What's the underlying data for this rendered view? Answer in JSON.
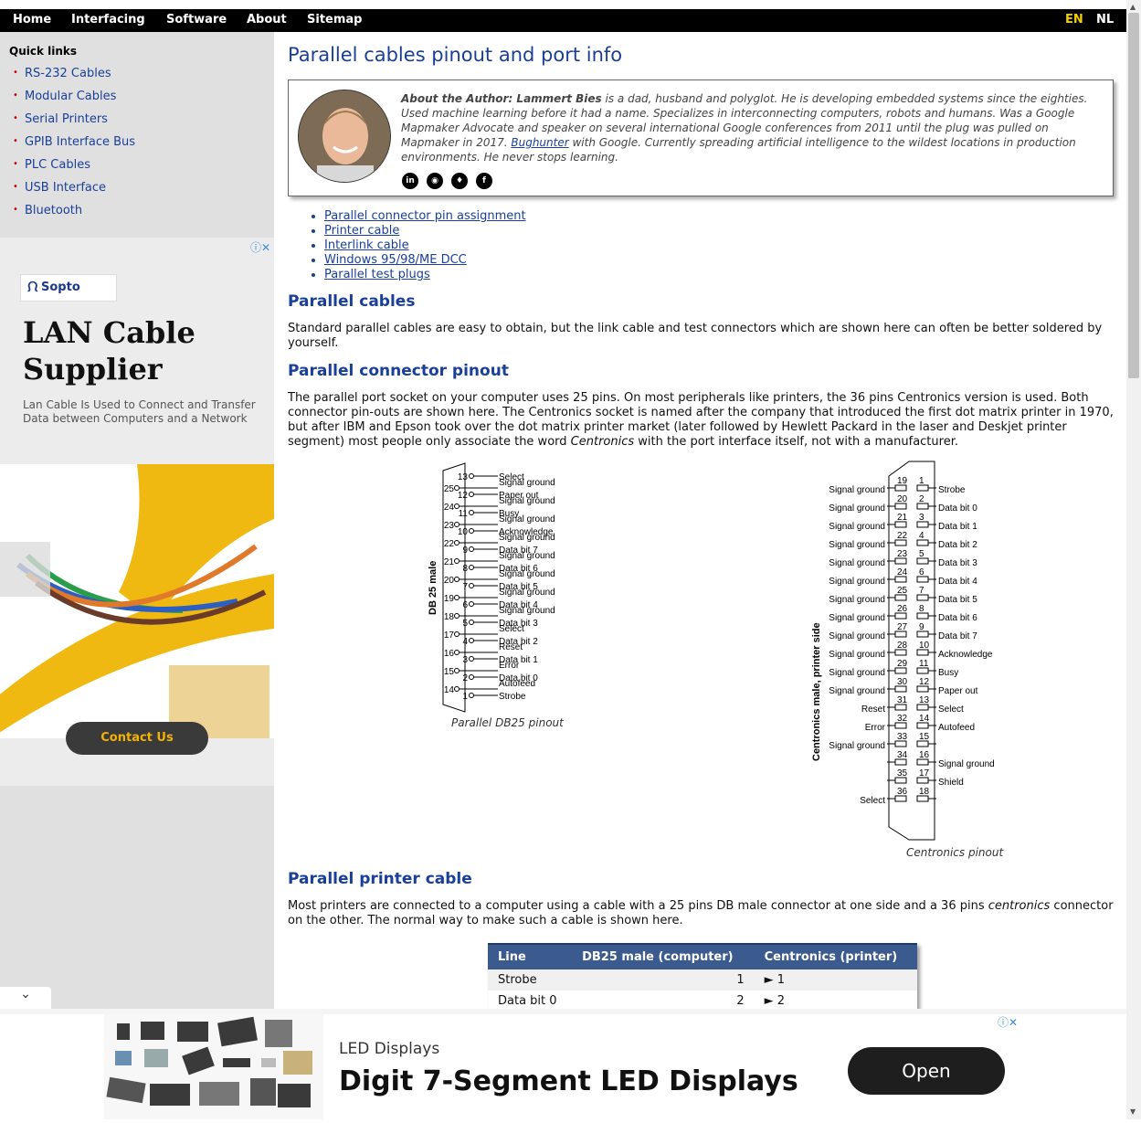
{
  "topnav": {
    "items": [
      "Home",
      "Interfacing",
      "Software",
      "About",
      "Sitemap"
    ],
    "lang_en": "EN",
    "lang_nl": "NL"
  },
  "sidebar": {
    "title": "Quick links",
    "links": [
      "RS-232 Cables",
      "Modular Cables",
      "Serial Printers",
      "GPIB Interface Bus",
      "PLC Cables",
      "USB Interface",
      "Bluetooth"
    ]
  },
  "ad_left": {
    "brand": "Sopto",
    "headline": "LAN Cable Supplier",
    "sub": "Lan Cable Is Used to Connect and Transfer Data between Computers and a Network",
    "cta": "Contact Us"
  },
  "page": {
    "title": "Parallel cables pinout and port info",
    "author": {
      "lead": "About the Author: Lammert Bies",
      "text1": " is a dad, husband and polyglot. He is developing embedded systems since the eighties. Used machine learning before it had a name. Specializes in interconnecting computers, robots and humans. Was a Google Mapmaker Advocate and speaker on several international Google conferences from 2011 until the plug was pulled on Mapmaker in 2017. ",
      "link": "Bughunter",
      "text2": " with Google. Currently spreading artificial intelligence to the wildest locations in production environments. He never stops learning.",
      "socials": [
        "linkedin-icon",
        "github-icon",
        "twitter-icon",
        "facebook-icon"
      ]
    },
    "toc": [
      "Parallel connector pin assignment",
      "Printer cable",
      "Interlink cable",
      "Windows 95/98/ME DCC",
      "Parallel test plugs"
    ],
    "sections": {
      "cables_title": "Parallel cables",
      "cables_text": "Standard parallel cables are easy to obtain, but the link cable and test connectors which are shown here can often be better soldered by yourself.",
      "pinout_title": "Parallel connector pinout",
      "pinout_text_a": "The parallel port socket on your computer uses 25 pins. On most peripherals like printers, the 36 pins Centronics version is used. Both connector pin-outs are shown here. The Centronics socket is named after the company that introduced the first dot matrix printer in 1970, but after IBM and Epson took over the dot matrix printer market (later followed by Hewlett Packard in the laser and Deskjet printer segment) most people only associate the word ",
      "pinout_text_em": "Centronics",
      "pinout_text_b": " with the port interface itself, not with a manufacturer.",
      "printer_title": "Parallel printer cable",
      "printer_text_a": "Most printers are connected to a computer using a cable with a 25 pins DB male connector at one side and a 36 pins ",
      "printer_text_em": "centronics",
      "printer_text_b": " connector on the other. The normal way to make such a cable is shown here."
    },
    "db25": {
      "caption": "Parallel DB25 pinout",
      "side_label": "DB 25 male",
      "top_row": [
        {
          "pin": "13",
          "label": "Select"
        },
        {
          "pin": "12",
          "label": "Paper out"
        },
        {
          "pin": "11",
          "label": "Busy"
        },
        {
          "pin": "10",
          "label": "Acknowledge"
        },
        {
          "pin": "9",
          "label": "Data bit 7"
        },
        {
          "pin": "8",
          "label": "Data bit 6"
        },
        {
          "pin": "7",
          "label": "Data bit 5"
        },
        {
          "pin": "6",
          "label": "Data bit 4"
        },
        {
          "pin": "5",
          "label": "Data bit 3"
        },
        {
          "pin": "4",
          "label": "Data bit 2"
        },
        {
          "pin": "3",
          "label": "Data bit 1"
        },
        {
          "pin": "2",
          "label": "Data bit 0"
        },
        {
          "pin": "1",
          "label": "Strobe"
        }
      ],
      "bottom_row": [
        {
          "pin": "25",
          "label": "Signal ground"
        },
        {
          "pin": "24",
          "label": "Signal ground"
        },
        {
          "pin": "23",
          "label": "Signal ground"
        },
        {
          "pin": "22",
          "label": "Signal ground"
        },
        {
          "pin": "21",
          "label": "Signal ground"
        },
        {
          "pin": "20",
          "label": "Signal ground"
        },
        {
          "pin": "19",
          "label": "Signal ground"
        },
        {
          "pin": "18",
          "label": "Signal ground"
        },
        {
          "pin": "17",
          "label": "Select"
        },
        {
          "pin": "16",
          "label": "Reset"
        },
        {
          "pin": "15",
          "label": "Error"
        },
        {
          "pin": "14",
          "label": "Autofeed"
        }
      ]
    },
    "centronics": {
      "caption": "Centronics pinout",
      "side_label": "Centronics male, printer side",
      "pairs": [
        {
          "l": "19",
          "r": "1",
          "ll": "Signal ground",
          "rl": "Strobe"
        },
        {
          "l": "20",
          "r": "2",
          "ll": "Signal ground",
          "rl": "Data bit 0"
        },
        {
          "l": "21",
          "r": "3",
          "ll": "Signal ground",
          "rl": "Data bit 1"
        },
        {
          "l": "22",
          "r": "4",
          "ll": "Signal ground",
          "rl": "Data bit 2"
        },
        {
          "l": "23",
          "r": "5",
          "ll": "Signal ground",
          "rl": "Data bit 3"
        },
        {
          "l": "24",
          "r": "6",
          "ll": "Signal ground",
          "rl": "Data bit 4"
        },
        {
          "l": "25",
          "r": "7",
          "ll": "Signal ground",
          "rl": "Data bit 5"
        },
        {
          "l": "26",
          "r": "8",
          "ll": "Signal ground",
          "rl": "Data bit 6"
        },
        {
          "l": "27",
          "r": "9",
          "ll": "Signal ground",
          "rl": "Data bit 7"
        },
        {
          "l": "28",
          "r": "10",
          "ll": "Signal ground",
          "rl": "Acknowledge"
        },
        {
          "l": "29",
          "r": "11",
          "ll": "Signal ground",
          "rl": "Busy"
        },
        {
          "l": "30",
          "r": "12",
          "ll": "Signal ground",
          "rl": "Paper out"
        },
        {
          "l": "31",
          "r": "13",
          "ll": "Reset",
          "rl": "Select"
        },
        {
          "l": "32",
          "r": "14",
          "ll": "Error",
          "rl": "Autofeed"
        },
        {
          "l": "33",
          "r": "15",
          "ll": "Signal ground",
          "rl": ""
        },
        {
          "l": "34",
          "r": "16",
          "ll": "",
          "rl": "Signal ground"
        },
        {
          "l": "35",
          "r": "17",
          "ll": "",
          "rl": "Shield"
        },
        {
          "l": "36",
          "r": "18",
          "ll": "Select",
          "rl": ""
        }
      ]
    },
    "printer_table": {
      "headers": [
        "Line",
        "DB25 male (computer)",
        "Centronics (printer)"
      ],
      "rows": [
        {
          "line": "Strobe",
          "db25": "1",
          "cent": "► 1"
        },
        {
          "line": "Data bit 0",
          "db25": "2",
          "cent": "► 2"
        }
      ]
    }
  },
  "ad_bottom": {
    "brand": "LED Displays",
    "headline": "Digit 7-Segment LED Displays",
    "cta": "Open"
  },
  "colors": {
    "link": "#1a3f99",
    "table_header": "#3b5a8e",
    "lang_active": "#f2d000"
  }
}
